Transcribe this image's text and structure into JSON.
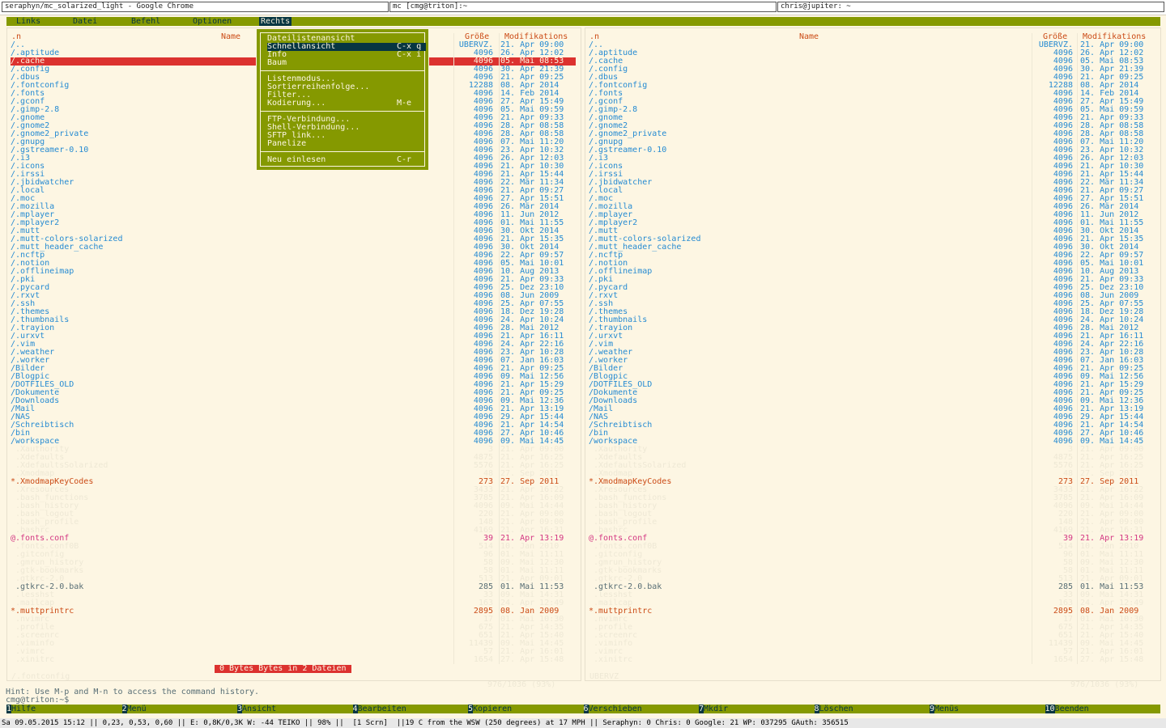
{
  "tabs": [
    "seraphyn/mc_solarized_light - Google Chrome",
    "mc [cmg@triton]:~",
    "chris@jupiter: ~"
  ],
  "menubar": [
    "Links",
    "Datei",
    "Befehl",
    "Optionen",
    "Rechts"
  ],
  "dropdown": [
    {
      "label": "Dateilistenansicht",
      "key": ""
    },
    {
      "label": "Schnellansicht",
      "key": "C-x q",
      "selected": true
    },
    {
      "label": "Info",
      "key": "C-x i"
    },
    {
      "label": "Baum",
      "key": ""
    },
    {
      "sep": true
    },
    {
      "label": "Listenmodus...",
      "key": ""
    },
    {
      "label": "Sortierreihenfolge...",
      "key": ""
    },
    {
      "label": "Filter...",
      "key": ""
    },
    {
      "label": "Kodierung...",
      "key": "M-e"
    },
    {
      "sep": true
    },
    {
      "label": "FTP-Verbindung...",
      "key": ""
    },
    {
      "label": "Shell-Verbindung...",
      "key": ""
    },
    {
      "label": "SFTP link...",
      "key": ""
    },
    {
      "label": "Panelize",
      "key": ""
    },
    {
      "sep": true
    },
    {
      "label": "Neu einlesen",
      "key": "C-r"
    }
  ],
  "columns": {
    "sort": ".n",
    "name": "Name",
    "size": "Größe",
    "modified": "Modifikations"
  },
  "files": [
    {
      "name": "/..",
      "size": "UBERVZ.",
      "date": "21. Apr 09:00",
      "t": "dir"
    },
    {
      "name": "/.aptitude",
      "size": "4096",
      "date": "26. Apr 12:02",
      "t": "dir"
    },
    {
      "name": "/.cache",
      "size": "4096",
      "date": "05. Mai 08:53",
      "t": "dir"
    },
    {
      "name": "/.config",
      "size": "4096",
      "date": "30. Apr 21:39",
      "t": "dir"
    },
    {
      "name": "/.dbus",
      "size": "4096",
      "date": "21. Apr 09:25",
      "t": "dir"
    },
    {
      "name": "/.fontconfig",
      "size": "12288",
      "date": "08. Apr 2014",
      "t": "dir"
    },
    {
      "name": "/.fonts",
      "size": "4096",
      "date": "14. Feb 2014",
      "t": "dir"
    },
    {
      "name": "/.gconf",
      "size": "4096",
      "date": "27. Apr 15:49",
      "t": "dir"
    },
    {
      "name": "/.gimp-2.8",
      "size": "4096",
      "date": "05. Mai 09:59",
      "t": "dir"
    },
    {
      "name": "/.gnome",
      "size": "4096",
      "date": "21. Apr 09:33",
      "t": "dir"
    },
    {
      "name": "/.gnome2",
      "size": "4096",
      "date": "28. Apr 08:58",
      "t": "dir"
    },
    {
      "name": "/.gnome2_private",
      "size": "4096",
      "date": "28. Apr 08:58",
      "t": "dir"
    },
    {
      "name": "/.gnupg",
      "size": "4096",
      "date": "07. Mai 11:20",
      "t": "dir"
    },
    {
      "name": "/.gstreamer-0.10",
      "size": "4096",
      "date": "23. Apr 10:32",
      "t": "dir"
    },
    {
      "name": "/.i3",
      "size": "4096",
      "date": "26. Apr 12:03",
      "t": "dir"
    },
    {
      "name": "/.icons",
      "size": "4096",
      "date": "21. Apr 10:30",
      "t": "dir"
    },
    {
      "name": "/.irssi",
      "size": "4096",
      "date": "21. Apr 15:44",
      "t": "dir"
    },
    {
      "name": "/.jbidwatcher",
      "size": "4096",
      "date": "22. Mär 11:34",
      "t": "dir"
    },
    {
      "name": "/.local",
      "size": "4096",
      "date": "21. Apr 09:27",
      "t": "dir"
    },
    {
      "name": "/.moc",
      "size": "4096",
      "date": "27. Apr 15:51",
      "t": "dir"
    },
    {
      "name": "/.mozilla",
      "size": "4096",
      "date": "26. Mär 2014",
      "t": "dir"
    },
    {
      "name": "/.mplayer",
      "size": "4096",
      "date": "11. Jun 2012",
      "t": "dir"
    },
    {
      "name": "/.mplayer2",
      "size": "4096",
      "date": "01. Mai 11:55",
      "t": "dir"
    },
    {
      "name": "/.mutt",
      "size": "4096",
      "date": "30. Okt 2014",
      "t": "dir"
    },
    {
      "name": "/.mutt-colors-solarized",
      "size": "4096",
      "date": "21. Apr 15:35",
      "t": "dir"
    },
    {
      "name": "/.mutt_header_cache",
      "size": "4096",
      "date": "30. Okt 2014",
      "t": "dir"
    },
    {
      "name": "/.ncftp",
      "size": "4096",
      "date": "22. Apr 09:57",
      "t": "dir"
    },
    {
      "name": "/.notion",
      "size": "4096",
      "date": "05. Mai 10:01",
      "t": "dir"
    },
    {
      "name": "/.offlineimap",
      "size": "4096",
      "date": "10. Aug 2013",
      "t": "dir"
    },
    {
      "name": "/.pki",
      "size": "4096",
      "date": "21. Apr 09:33",
      "t": "dir"
    },
    {
      "name": "/.pycard",
      "size": "4096",
      "date": "25. Dez 23:10",
      "t": "dir"
    },
    {
      "name": "/.rxvt",
      "size": "4096",
      "date": "08. Jun 2009",
      "t": "dir"
    },
    {
      "name": "/.ssh",
      "size": "4096",
      "date": "25. Apr 07:55",
      "t": "dir"
    },
    {
      "name": "/.themes",
      "size": "4096",
      "date": "18. Dez 19:28",
      "t": "dir"
    },
    {
      "name": "/.thumbnails",
      "size": "4096",
      "date": "24. Apr 10:24",
      "t": "dir"
    },
    {
      "name": "/.trayion",
      "size": "4096",
      "date": "28. Mai 2012",
      "t": "dir"
    },
    {
      "name": "/.urxvt",
      "size": "4096",
      "date": "21. Apr 16:11",
      "t": "dir"
    },
    {
      "name": "/.vim",
      "size": "4096",
      "date": "24. Apr 22:16",
      "t": "dir"
    },
    {
      "name": "/.weather",
      "size": "4096",
      "date": "23. Apr 10:28",
      "t": "dir"
    },
    {
      "name": "/.worker",
      "size": "4096",
      "date": "07. Jan 16:03",
      "t": "dir"
    },
    {
      "name": "/Bilder",
      "size": "4096",
      "date": "21. Apr 09:25",
      "t": "dir"
    },
    {
      "name": "/Blogpic",
      "size": "4096",
      "date": "09. Mai 12:56",
      "t": "dir"
    },
    {
      "name": "/DOTFILES_OLD",
      "size": "4096",
      "date": "21. Apr 15:29",
      "t": "dir"
    },
    {
      "name": "/Dokumente",
      "size": "4096",
      "date": "21. Apr 09:25",
      "t": "dir"
    },
    {
      "name": "/Downloads",
      "size": "4096",
      "date": "09. Mai 12:36",
      "t": "dir"
    },
    {
      "name": "/Mail",
      "size": "4096",
      "date": "21. Apr 13:19",
      "t": "dir"
    },
    {
      "name": "/NAS",
      "size": "4096",
      "date": "29. Apr 15:44",
      "t": "dir"
    },
    {
      "name": "/Schreibtisch",
      "size": "4096",
      "date": "21. Apr 14:54",
      "t": "dir"
    },
    {
      "name": "/bin",
      "size": "4096",
      "date": "27. Apr 10:46",
      "t": "dir"
    },
    {
      "name": "/workspace",
      "size": "4096",
      "date": "09. Mai 14:45",
      "t": "dir"
    },
    {
      "name": " .Xauthority",
      "size": "3",
      "date": "21. Apr 09:00",
      "t": "dim"
    },
    {
      "name": " .Xdefaults",
      "size": "4875",
      "date": "21. Apr 16:25",
      "t": "dim"
    },
    {
      "name": " .XdefaultsSolarized",
      "size": "5576",
      "date": "21. Apr 16:25",
      "t": "dim"
    },
    {
      "name": " .Xmodmap",
      "size": "48",
      "date": "27. Sep 2011",
      "t": "dim"
    },
    {
      "name": "*.XmodmapKeyCodes",
      "size": "273",
      "date": "27. Sep 2011",
      "t": "exe"
    },
    {
      "name": " .Xresources",
      "size": "3433",
      "date": "21. Apr 16:22",
      "t": "dim"
    },
    {
      "name": " .bash_functions",
      "size": "3785",
      "date": "21. Apr 16:09",
      "t": "dim"
    },
    {
      "name": " .bash_history",
      "size": "4096",
      "date": "09. Mai 14:44",
      "t": "dim"
    },
    {
      "name": " .bash_logout",
      "size": "220",
      "date": "21. Apr 09:00",
      "t": "dim"
    },
    {
      "name": " .bash_profile",
      "size": "148",
      "date": "21. Apr 09:00",
      "t": "dim"
    },
    {
      "name": " .bashrc",
      "size": "4169",
      "date": "21. Apr 16:31",
      "t": "dim"
    },
    {
      "name": "@.fonts.conf",
      "size": "39",
      "date": "21. Apr 13:19",
      "t": "lnk"
    },
    {
      "name": " .fonts.conf0B",
      "size": "514",
      "date": "10. Jan 2010",
      "t": "dim"
    },
    {
      "name": " .gitconfig",
      "size": "96",
      "date": "01. Mai 11:11",
      "t": "dim"
    },
    {
      "name": " .gmrun_history",
      "size": "58",
      "date": "09. Mai 12:30",
      "t": "dim"
    },
    {
      "name": " .gtk-bookmarks",
      "size": "58",
      "date": "01. Mai 11:11",
      "t": "dim"
    },
    {
      "name": " .gtkrc-2.0",
      "size": "513",
      "date": "21. Apr 09:01",
      "t": "dim"
    },
    {
      "name": " .gtkrc-2.0.bak",
      "size": "285",
      "date": "01. Mai 11:53",
      "t": "bak"
    },
    {
      "name": " .lesshst",
      "size": "33",
      "date": "09. Mai 14:31",
      "t": "dim"
    },
    {
      "name": " .mailcap",
      "size": "163",
      "date": "24. Apr 12:49",
      "t": "dim"
    },
    {
      "name": "*.muttprintrc",
      "size": "2895",
      "date": "08. Jan 2009",
      "t": "exe"
    },
    {
      "name": " .nvimrc",
      "size": "17",
      "date": "01. Mai 10:30",
      "t": "dim"
    },
    {
      "name": " .profile",
      "size": "675",
      "date": "21. Apr 14:35",
      "t": "dim"
    },
    {
      "name": " .screenrc",
      "size": "651",
      "date": "21. Apr 15:40",
      "t": "dim"
    },
    {
      "name": " .viminfo",
      "size": "11439",
      "date": "09. Mai 14:45",
      "t": "dim"
    },
    {
      "name": " .vimrc",
      "size": "57",
      "date": "21. Apr 16:01",
      "t": "dim"
    },
    {
      "name": " .xinitrc",
      "size": "1654",
      "date": "27. Apr 15:48",
      "t": "dim"
    }
  ],
  "left_panel": {
    "selected_index": 2,
    "footer_left": "/.fontconfig",
    "footer_right": "976/1036 (93%)"
  },
  "right_panel": {
    "footer_left": "UBERVZ",
    "footer_right": "976/1036 (93%)"
  },
  "summary": "0 Bytes Bytes in 2 Dateien",
  "hint": "Hint: Use M-p and M-n to access the command history.",
  "prompt": "cmg@triton:~$",
  "fkeys": [
    {
      "n": "1",
      "label": "Hilfe"
    },
    {
      "n": "2",
      "label": "Menü"
    },
    {
      "n": "3",
      "label": "Ansicht"
    },
    {
      "n": "4",
      "label": "Bearbeiten"
    },
    {
      "n": "5",
      "label": "Kopieren"
    },
    {
      "n": "6",
      "label": "Verschieben"
    },
    {
      "n": "7",
      "label": "Mkdir"
    },
    {
      "n": "8",
      "label": "Löschen"
    },
    {
      "n": "9",
      "label": "Menüs"
    },
    {
      "n": "10",
      "label": "Beenden"
    }
  ],
  "statusbar": "Sa 09.05.2015 15:12 || 0,23, 0,53, 0,60 || E: 0,8K/0,3K W: -44 TEIKO || 98% ||  [1 Scrn]  ||19 C from the WSW (250 degrees) at 17 MPH || Seraphyn: 0 Chris: 0 Google: 21 WP: 037295 GAuth: 356515",
  "colors": {
    "base3": "#fdf6e3",
    "blue": "#268bd2",
    "red": "#dc322f",
    "green": "#859900",
    "orange": "#cb4b16",
    "magenta": "#d33682",
    "dark": "#073642"
  }
}
